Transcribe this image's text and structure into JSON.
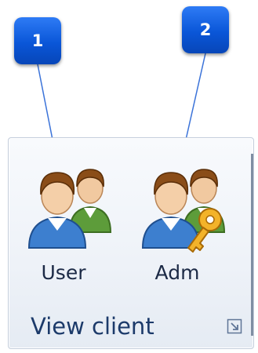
{
  "callouts": [
    {
      "number": "1"
    },
    {
      "number": "2"
    }
  ],
  "ribbon_group": {
    "title": "View client",
    "buttons": [
      {
        "label": "User",
        "icon": "users-icon"
      },
      {
        "label": "Adm",
        "icon": "admin-users-key-icon"
      }
    ],
    "launcher_icon": "dialog-launcher-icon"
  },
  "colors": {
    "callout_blue": "#0a56d8",
    "label_text": "#1c2a46",
    "group_title": "#1c3a6a",
    "leader_line": "#3b73d9"
  }
}
